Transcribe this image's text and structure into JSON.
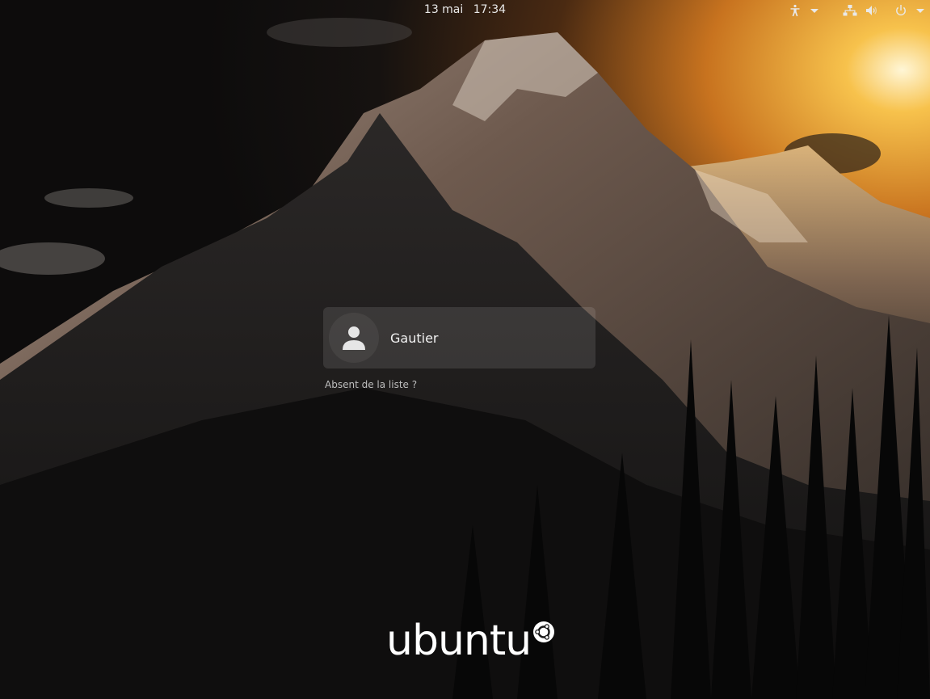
{
  "topbar": {
    "date": "13 mai",
    "time": "17:34",
    "icons": [
      "accessibility-icon",
      "chevron-down-icon",
      "network-icon",
      "volume-icon",
      "power-icon",
      "chevron-down-icon"
    ]
  },
  "login": {
    "user_name": "Gautier",
    "avatar_icon": "user-avatar-icon",
    "not_listed_label": "Absent de la liste ?"
  },
  "branding": {
    "logo_text": "ubuntu",
    "logo_icon": "circle-of-friends-icon"
  },
  "colors": {
    "text": "#f2f2f2",
    "secondary_text": "#bdbdbd",
    "panel": "rgba(255,255,255,0.11)",
    "sky_glow": "#f5a623"
  }
}
